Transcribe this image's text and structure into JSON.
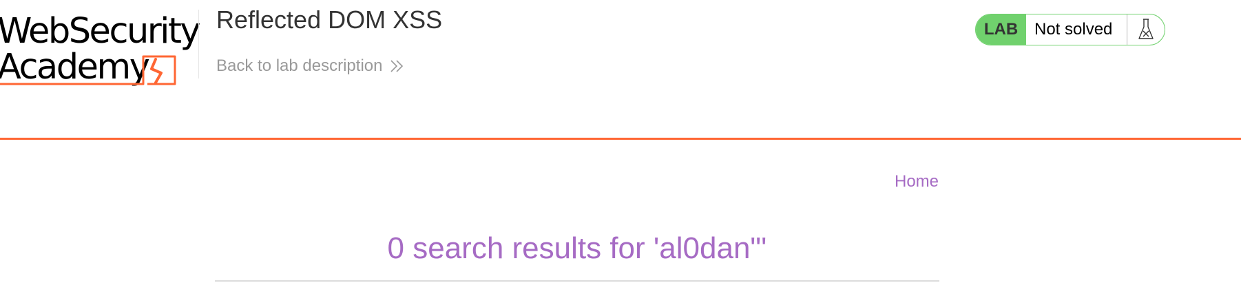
{
  "brand": {
    "logo_line1": "WebSecurity",
    "logo_line2": "Academy",
    "accent_color": "#ff6633"
  },
  "lab": {
    "title": "Reflected DOM XSS",
    "back_link_label": "Back to lab description",
    "back_link_icon": "double-chevron-right-icon"
  },
  "status": {
    "badge_label": "LAB",
    "text": "Not solved",
    "icon": "flask-icon",
    "badge_color": "#70d16d"
  },
  "nav": {
    "home_label": "Home",
    "link_color": "#a66bc4"
  },
  "results": {
    "heading": "0 search results for 'al0dan\"'"
  }
}
